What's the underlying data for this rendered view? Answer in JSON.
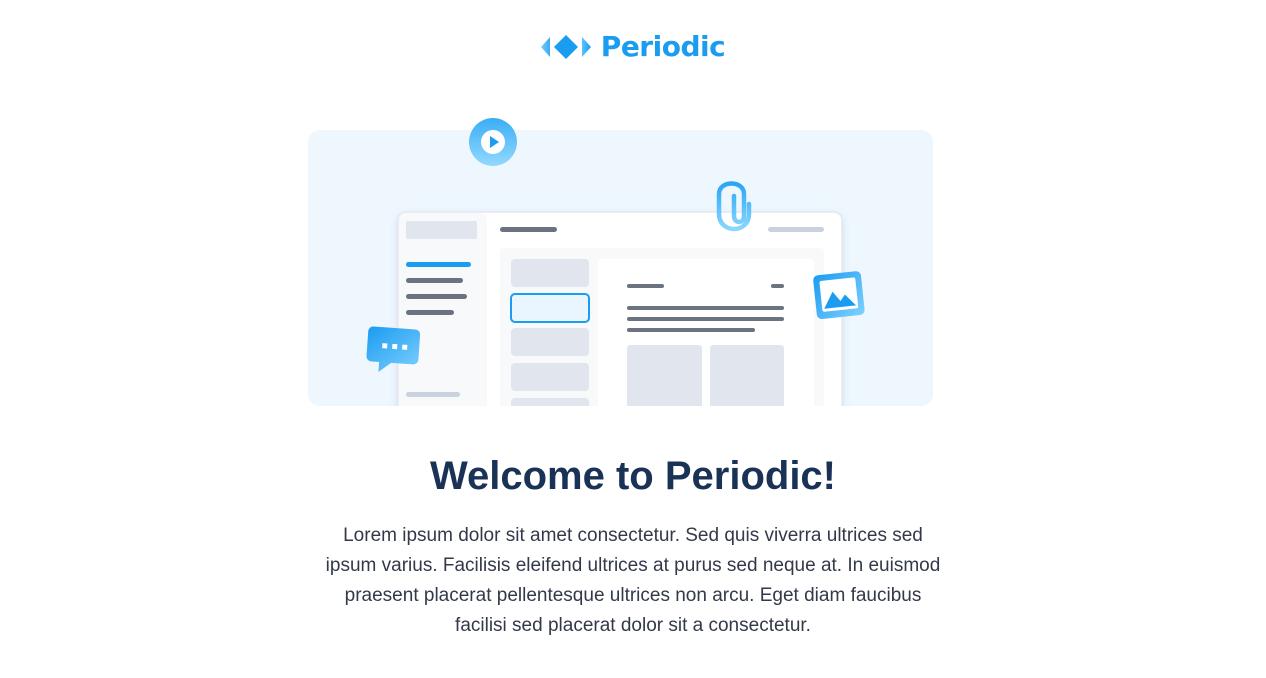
{
  "brand": {
    "name": "Periodic",
    "logo_icon": "periodic-diamond-logo-icon",
    "color": "#1a9cf0"
  },
  "hero": {
    "background_color": "#eef7fe",
    "icons": [
      "play-icon",
      "paperclip-icon",
      "image-icon",
      "chat-bubble-icon"
    ],
    "accent_color": "#1a9cf0"
  },
  "heading": "Welcome to Periodic!",
  "paragraph": "Lorem ipsum dolor sit amet consectetur. Sed quis viverra ultrices sed ipsum varius. Facilisis eleifend ultrices at purus sed neque at. In euismod praesent placerat pellentesque ultrices non arcu. Eget diam faucibus facilisi sed placerat dolor sit a consectetur.",
  "colors": {
    "heading": "#1b3257",
    "body": "#33394a"
  }
}
